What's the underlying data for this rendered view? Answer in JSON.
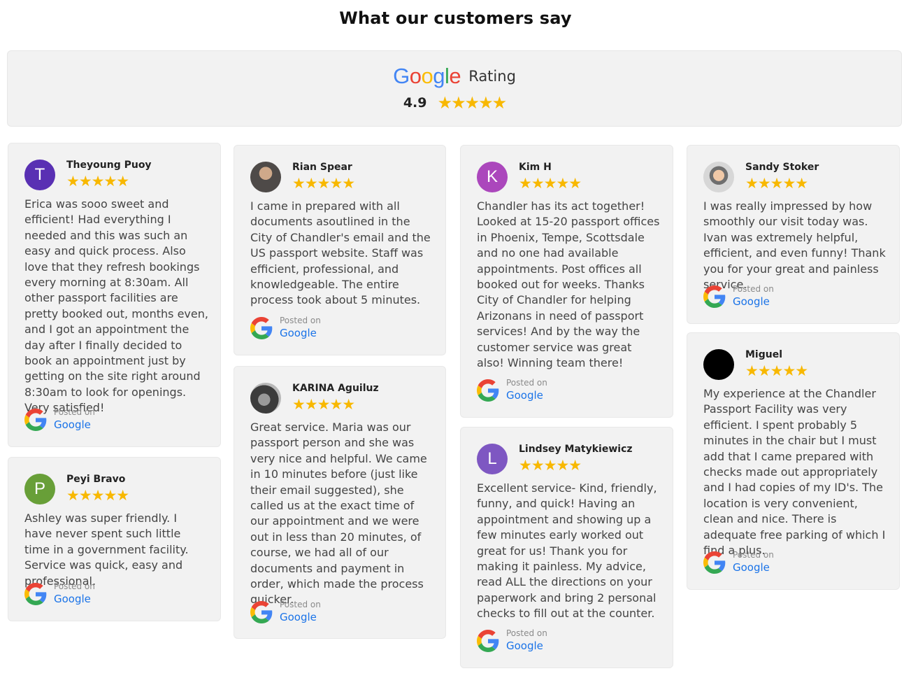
{
  "page": {
    "title": "What our customers say"
  },
  "summary": {
    "logo_letters": [
      "G",
      "o",
      "o",
      "g",
      "l",
      "e"
    ],
    "rating_label": "Rating",
    "score": "4.9",
    "stars": "★★★★★"
  },
  "colors": {
    "star": "#F8B800",
    "link": "#1a73e8",
    "card_bg": "#f2f2f2"
  },
  "posted": {
    "posted_on": "Posted on",
    "source": "Google"
  },
  "reviews": [
    {
      "name": "Theyoung Puoy",
      "initial": "T",
      "avatar_color": "#5930b3",
      "stars": "★★★★★",
      "text": "Erica was sooo sweet and efficient! Had everything I needed and this was such an easy and quick process. Also love that they refresh bookings every morning at 8:30am. All other passport facilities are pretty booked out, months even, and I got an appointment the day after I finally decided to book an appointment just by getting on the site right around 8:30am to look for openings. Very satisfied!"
    },
    {
      "name": "Peyi Bravo",
      "initial": "P",
      "avatar_color": "#689f38",
      "stars": "★★★★★",
      "text": "Ashley was super friendly. I have never spent such little time in a government facility. Service was quick, easy and professional."
    },
    {
      "name": "Rian Spear",
      "initial": "",
      "avatar_color": "#555555",
      "stars": "★★★★★",
      "text": "I came in prepared with all documents asoutlined in the City of Chandler's email and the US passport website. Staff was efficient, professional, and knowledgeable. The entire process took about 5 minutes."
    },
    {
      "name": "KARINA Aguiluz",
      "initial": "",
      "avatar_color": "#555555",
      "stars": "★★★★★",
      "text": "Great service. Maria was our passport person and she was very nice and helpful. We came in 10 minutes before (just like their email suggested), she called us at the exact time of our appointment and we were out in less than 20 minutes, of course, we had all of our documents and payment in order, which made the process quicker."
    },
    {
      "name": "Kim H",
      "initial": "K",
      "avatar_color": "#ab47bc",
      "stars": "★★★★★",
      "text": "Chandler has its act together! Looked at 15-20 passport offices in Phoenix, Tempe, Scottsdale and no one had available appointments. Post offices all booked out for weeks. Thanks City of Chandler for helping Arizonans in need of passport services! And by the way the customer service was great also! Winning team there!"
    },
    {
      "name": "Lindsey Matykiewicz",
      "initial": "L",
      "avatar_color": "#7e57c2",
      "stars": "★★★★★",
      "text": "Excellent service- Kind, friendly, funny, and quick! Having an appointment and showing up a few minutes early worked out great for us! Thank you for making it painless. My advice, read ALL the directions on your paperwork and bring 2 personal checks to fill out at the counter."
    },
    {
      "name": "Sandy Stoker",
      "initial": "",
      "avatar_color": "#555555",
      "stars": "★★★★★",
      "text": "I was really impressed by how smoothly our visit today was. Ivan was extremely helpful, efficient, and even funny! Thank you for your great and painless service."
    },
    {
      "name": "Miguel",
      "initial": "",
      "avatar_color": "#000000",
      "stars": "★★★★★",
      "text": "My experience at the Chandler Passport Facility was very efficient. I spent probably 5 minutes in the chair but I must add that I came prepared with checks made out appropriately and I had copies of my ID's. The location is very convenient, clean and nice. There is adequate free parking of which I find a plus."
    }
  ]
}
